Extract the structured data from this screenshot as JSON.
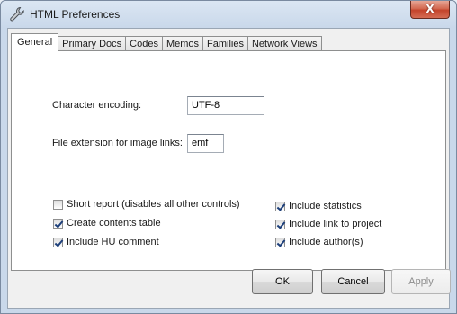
{
  "window": {
    "title": "HTML Preferences",
    "close_glyph": "X",
    "app_icon": "wrench-icon"
  },
  "tabs": [
    {
      "label": "General",
      "active": true
    },
    {
      "label": "Primary Docs",
      "active": false
    },
    {
      "label": "Codes",
      "active": false
    },
    {
      "label": "Memos",
      "active": false
    },
    {
      "label": "Families",
      "active": false
    },
    {
      "label": "Network Views",
      "active": false
    }
  ],
  "general": {
    "encoding_label": "Character encoding:",
    "encoding_value": "UTF-8",
    "extension_label": "File extension for image links:",
    "extension_value": "emf"
  },
  "options": {
    "short_report": {
      "label": "Short report (disables all other controls)",
      "checked": false
    },
    "create_contents_table": {
      "label": "Create contents table",
      "checked": true
    },
    "include_hu_comment": {
      "label": "Include HU comment",
      "checked": true
    },
    "include_statistics": {
      "label": "Include statistics",
      "checked": true
    },
    "include_link_to_project": {
      "label": "Include link to project",
      "checked": true
    },
    "include_authors": {
      "label": "Include author(s)",
      "checked": true
    }
  },
  "buttons": {
    "ok": "OK",
    "cancel": "Cancel",
    "apply": "Apply"
  }
}
